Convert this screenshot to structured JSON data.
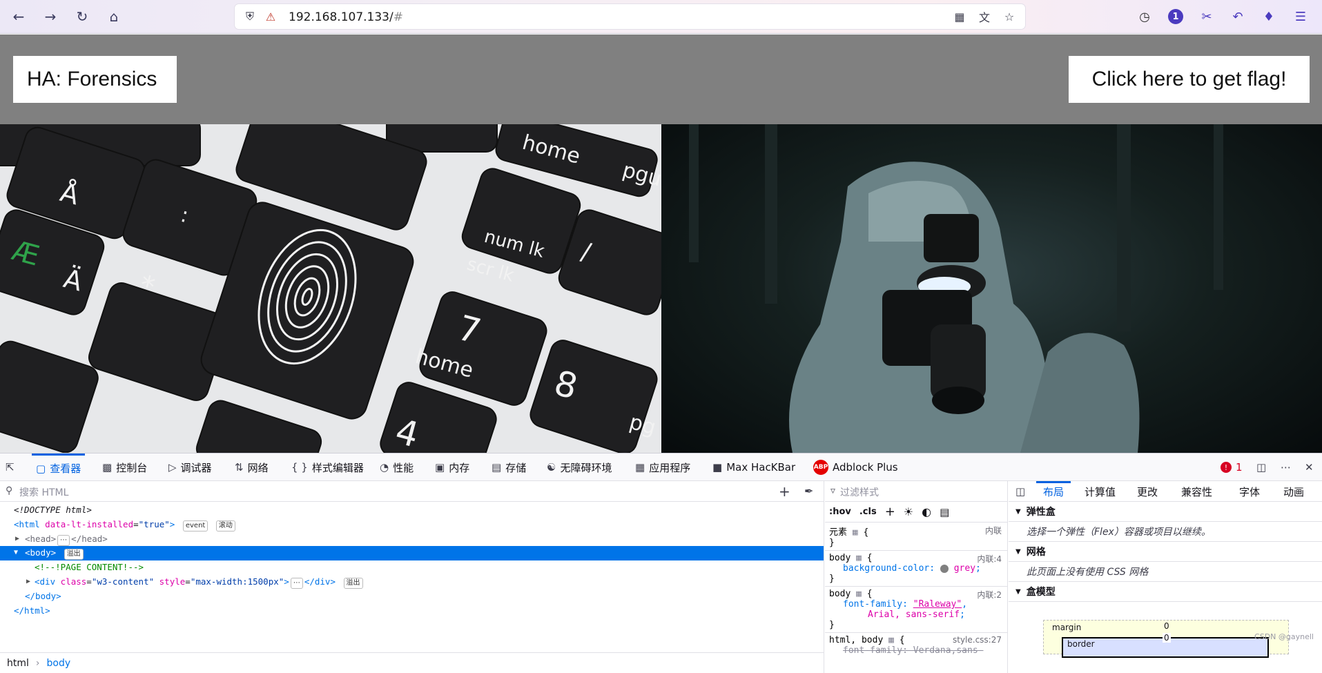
{
  "browser": {
    "url_host": "192.168.107.133/",
    "url_hash": "#",
    "ext_badge": "1"
  },
  "page": {
    "title": "HA: Forensics",
    "flag_button": "Click here to get flag!"
  },
  "devtools": {
    "tabs": [
      {
        "label": "查看器"
      },
      {
        "label": "控制台"
      },
      {
        "label": "调试器"
      },
      {
        "label": "网络"
      },
      {
        "label": "样式编辑器"
      },
      {
        "label": "性能"
      },
      {
        "label": "内存"
      },
      {
        "label": "存储"
      },
      {
        "label": "无障碍环境"
      },
      {
        "label": "应用程序"
      },
      {
        "label": "Max HacKBar"
      },
      {
        "label": "Adblock Plus"
      }
    ],
    "error_count": "1",
    "search_placeholder": "搜索 HTML",
    "filter_placeholder": "过滤样式",
    "rule_toolbar": {
      "hov": ":hov",
      "cls": ".cls"
    },
    "tree": {
      "doctype": "<!DOCTYPE html>",
      "html_open_tag": "<html",
      "html_attr": "data-lt-installed",
      "html_attr_val": "\"true\"",
      "event_badge": "event",
      "scroll_badge": "滚动",
      "head": "<head>",
      "head_close": "</head>",
      "body": "<body>",
      "overflow_badge": "溢出",
      "comment": "<!--!PAGE CONTENT!-->",
      "div_open": "<div",
      "div_class_attr": "class",
      "div_class_val": "\"w3-content\"",
      "div_style_attr": "style",
      "div_style_val": "\"max-width:1500px\"",
      "div_close": "</div>",
      "body_close": "</body>",
      "html_close": "</html>"
    },
    "breadcrumb": [
      "html",
      "body"
    ],
    "rules": {
      "element_label": "元素",
      "element_src": "内联",
      "body_selector": "body",
      "rule1_src": "内联:4",
      "rule1_prop": "background-color",
      "rule1_val": "grey",
      "rule2_src": "内联:2",
      "rule2_prop": "font-family",
      "rule2_val1": "\"Raleway\"",
      "rule2_val2": "Arial, sans-serif",
      "rule3_selector": "html, body",
      "rule3_src": "style.css:27",
      "rule3_prop": "font-family: Verdana,sans-"
    },
    "layout_tabs": [
      "布局",
      "计算值",
      "更改",
      "兼容性",
      "字体",
      "动画"
    ],
    "layout": {
      "flex_title": "弹性盒",
      "flex_desc": "选择一个弹性（Flex）容器或项目以继续。",
      "grid_title": "网格",
      "grid_desc": "此页面上没有使用 CSS 网格",
      "box_title": "盒模型",
      "margin_label": "margin",
      "margin_val": "0",
      "border_label": "border",
      "border_val": "0"
    },
    "watermark": "CSDN @gaynell"
  }
}
